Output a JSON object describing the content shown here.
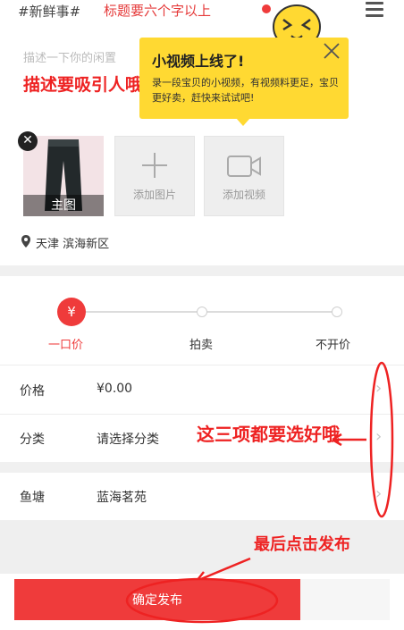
{
  "title": {
    "tag": "#新鲜事#",
    "hint": "标题要六个字以上"
  },
  "description": {
    "placeholder": "描述一下你的闲置",
    "annotation": "描述要吸引人哦，宝贝也要描述清楚"
  },
  "tooltip": {
    "title": "小视频上线了!",
    "body": "录一段宝贝的小视频，有视频料更足，宝贝更好卖，赶快来试试吧!"
  },
  "media": {
    "main_label": "主图",
    "add_image_label": "添加图片",
    "add_video_label": "添加视频"
  },
  "location": "天津 滨海新区",
  "pricing_modes": {
    "active_symbol": "¥",
    "options": [
      "一口价",
      "拍卖",
      "不开价"
    ],
    "selected": "一口价"
  },
  "form": {
    "price": {
      "label": "价格",
      "value": "¥0.00"
    },
    "category": {
      "label": "分类",
      "value": "请选择分类"
    },
    "pond": {
      "label": "鱼塘",
      "value": "蓝海茗苑"
    }
  },
  "annotations": {
    "three_items": "这三项都要选好哦",
    "publish_hint": "最后点击发布"
  },
  "publish_button": "确定发布",
  "colors": {
    "accent": "#ef3b3b",
    "annotation": "#e22222",
    "tooltip": "#ffd932"
  },
  "icons": [
    "menu-icon",
    "mascot-icon",
    "close-icon",
    "remove-icon",
    "plus-icon",
    "video-camera-icon",
    "location-pin-icon",
    "chevron-right-icon"
  ]
}
